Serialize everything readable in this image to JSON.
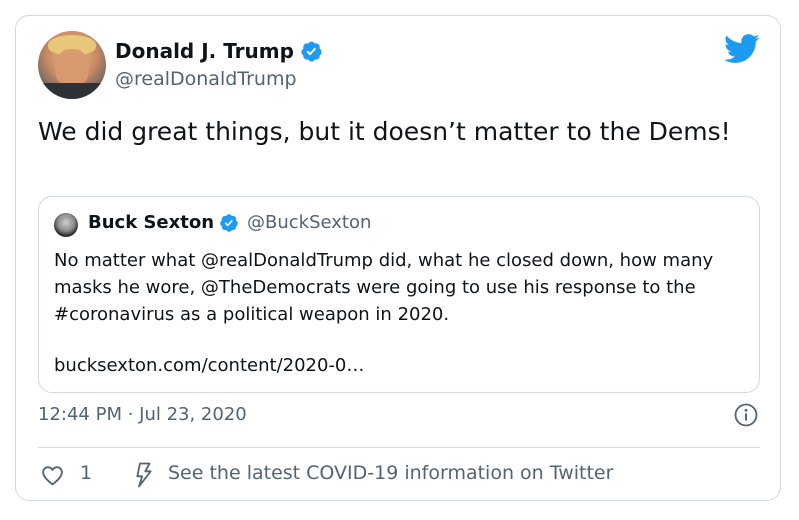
{
  "author": {
    "name": "Donald J. Trump",
    "handle": "@realDonaldTrump"
  },
  "tweet": {
    "text": "We did great things, but it doesn’t matter to the Dems!"
  },
  "quoted_tweet": {
    "name": "Buck Sexton",
    "handle": "@BuckSexton",
    "text": "No matter what @realDonaldTrump did, what he closed down, how many masks he wore, @TheDemocrats were going to use his response to the #coronavirus as a political weapon in 2020.",
    "link": "bucksexton.com/content/2020-0…"
  },
  "meta": {
    "timestamp": "12:44 PM · Jul 23, 2020"
  },
  "actions": {
    "like_count": "1",
    "covid_info": "See the latest COVID-19 information on Twitter"
  },
  "icons": {
    "verified": "verified-badge-icon",
    "twitter": "twitter-bird-icon",
    "info": "info-icon",
    "heart": "heart-icon",
    "bolt": "lightning-bolt-icon"
  },
  "colors": {
    "verified_blue": "#1d9bf0",
    "secondary_text": "#536471",
    "border": "#cfd9de"
  }
}
